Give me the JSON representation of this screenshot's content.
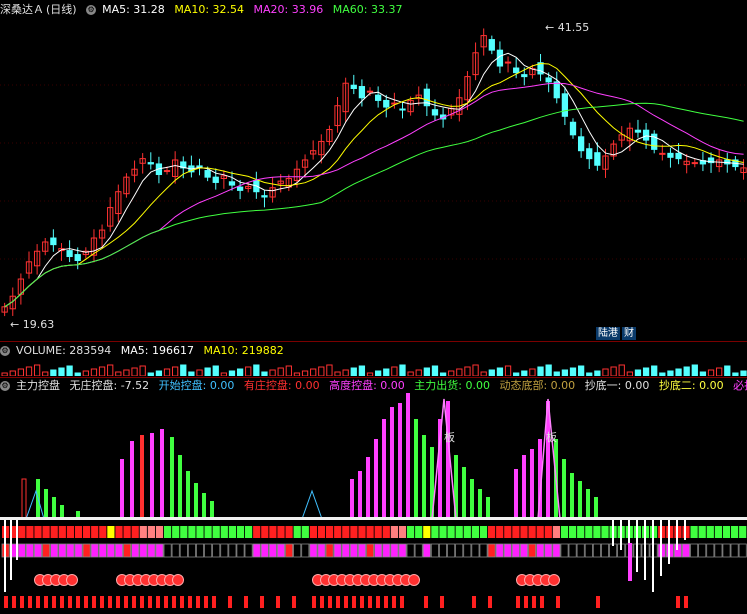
{
  "header": {
    "symbol": "深桑达Ａ",
    "period": "(日线)",
    "ma5": "MA5: 31.28",
    "ma10": "MA10: 32.54",
    "ma20": "MA20: 33.96",
    "ma60": "MA60: 33.37"
  },
  "price_panel": {
    "high_label": "41.55",
    "low_label": "19.63",
    "badge_left": "陆港",
    "badge_right": "财"
  },
  "volume_header": {
    "volume": "VOLUME: 283594",
    "ma5": "MA5: 196617",
    "ma10": "MA10: 219882"
  },
  "indicator_header": {
    "name": "主力控盘",
    "items": [
      {
        "text": "无庄控盘: -7.52",
        "color": "#e0e0e0"
      },
      {
        "text": "开始控盘: 0.00",
        "color": "#40c0ff"
      },
      {
        "text": "有庄控盘: 0.00",
        "color": "#ff3030"
      },
      {
        "text": "高度控盘: 0.00",
        "color": "#ff40ff"
      },
      {
        "text": "主力出货: 0.00",
        "color": "#40ff40"
      },
      {
        "text": "动态底部: 0.00",
        "color": "#c0a040"
      },
      {
        "text": "抄底一: 0.00",
        "color": "#e0e0e0"
      },
      {
        "text": "抄底二: 0.00",
        "color": "#ffff40"
      },
      {
        "text": "必抄底",
        "color": "#ff40ff"
      }
    ],
    "marker_label": "板"
  },
  "colors": {
    "up": "#ff3232",
    "down": "#54ffff",
    "ma5": "#ffffff",
    "ma10": "#ffff00",
    "ma20": "#ff40ff",
    "ma60": "#40ff40"
  },
  "chart_data": {
    "type": "candlestick",
    "y_range": [
      19.63,
      41.55
    ],
    "ma_values": {
      "MA5": 31.28,
      "MA10": 32.54,
      "MA20": 33.96,
      "MA60": 33.37
    }
  }
}
